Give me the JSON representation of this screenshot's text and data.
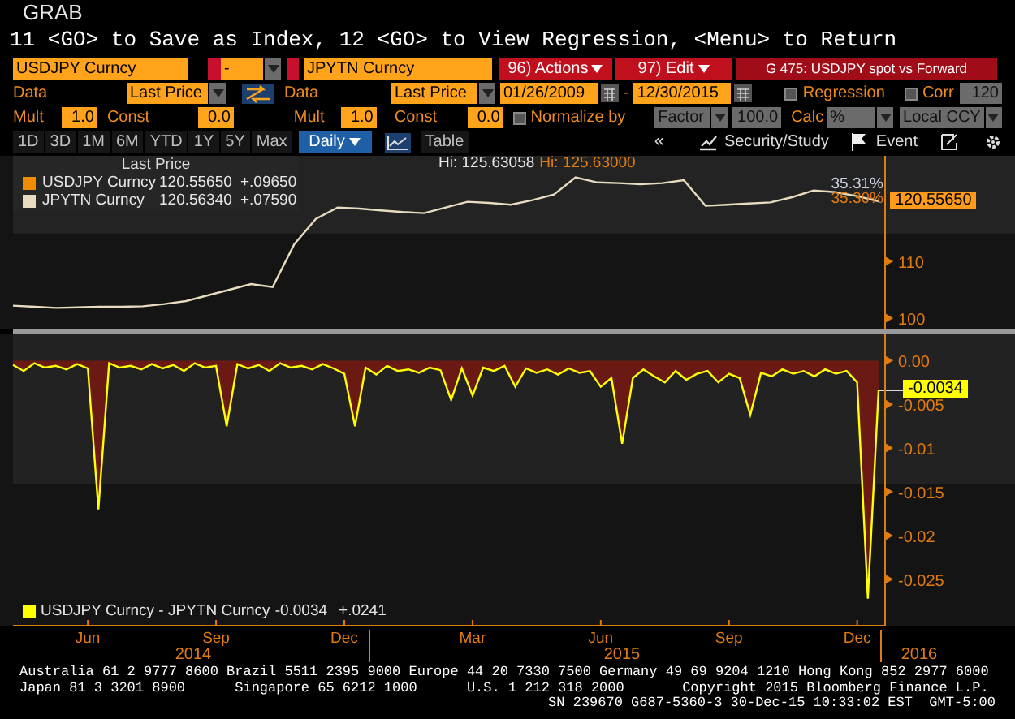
{
  "header": {
    "title": "GRAB",
    "command": "11 <GO> to Save as Index, 12 <GO> to View Regression, <Menu> to Return"
  },
  "toolbar": {
    "security_1": "USDJPY Curncy",
    "operator": "-",
    "security_2": "JPYTN Curncy",
    "actions": "96) Actions",
    "edit": "97) Edit",
    "chart_title": "G 475: USDJPY spot vs Forward"
  },
  "data_row": {
    "data_label_1": "Data",
    "field_1": "Last Price",
    "data_label_2": "Data",
    "field_2": "Last Price",
    "start_date": "01/26/2009",
    "date_separator": "-",
    "end_date": "12/30/2015",
    "options": [
      {
        "label": "Regression",
        "checked": false
      },
      {
        "label": "Corr",
        "checked": false
      }
    ],
    "corr_period": "120"
  },
  "scale_row": {
    "mult_label_1": "Mult",
    "mult_1": "1.0",
    "const_label_1": "Const",
    "const_1": "0.0",
    "mult_label_2": "Mult",
    "mult_2": "1.0",
    "const_label_2": "Const",
    "const_2": "0.0",
    "normalize": {
      "label": "Normalize by",
      "checked": false
    },
    "factor": "Factor",
    "factor_value": "100.0",
    "calc_label": "Calc",
    "calc": "%",
    "currency": "Local CCY"
  },
  "period_row": {
    "periods": [
      {
        "label": "1D",
        "selected": false
      },
      {
        "label": "3D",
        "selected": false
      },
      {
        "label": "1M",
        "selected": false
      },
      {
        "label": "6M",
        "selected": false
      },
      {
        "label": "YTD",
        "selected": false
      },
      {
        "label": "1Y",
        "selected": false
      },
      {
        "label": "5Y",
        "selected": false
      },
      {
        "label": "Max",
        "selected": false
      }
    ],
    "frequency": "Daily",
    "table": "Table",
    "collapse": "«",
    "security_study": "Security/Study",
    "event": "Event"
  },
  "price_chart": {
    "legend": {
      "title": "Last Price",
      "items": [
        {
          "name": "USDJPY Curncy",
          "value": "120.55650",
          "change": "+.09650",
          "color": "#f08c00"
        },
        {
          "value": "120.56340",
          "change": "+.07590"
        }
      ]
    },
    "hi_labels": [
      {
        "text": "Hi: 125.63058",
        "color": "#e6e6e6"
      },
      {
        "text": "Hi: 125.63000",
        "color": "#e07b10"
      }
    ],
    "pct_labels": [
      {
        "text": "35.31%",
        "color": "#c8d0e0"
      },
      {
        "text": "35.30%",
        "color": "#e07b10"
      }
    ],
    "last_value": "120.55650",
    "chart_data": {
      "type": "line",
      "ylim": [
        98,
        128.6
      ],
      "yticks": [
        100,
        110
      ],
      "bands": [
        {
          "axis": "y",
          "from": 114.9,
          "to": 128.6,
          "color": "#232323"
        }
      ],
      "categories": [
        null,
        null,
        null,
        null,
        null,
        null,
        null,
        null,
        null,
        null,
        null,
        null,
        null,
        null,
        null,
        null,
        null,
        null,
        null,
        null,
        null,
        null,
        null,
        null,
        null,
        null,
        null,
        null,
        null,
        null,
        null,
        null,
        null,
        null,
        null,
        null,
        null,
        null,
        null,
        null,
        null
      ],
      "series": [
        {
          "name": "JPYTN Curncy",
          "color": "#e8dcc0",
          "values": [
            102.2,
            102,
            101.8,
            101.9,
            102,
            102,
            102.1,
            102.5,
            103,
            104,
            105,
            106,
            105.5,
            113,
            117.5,
            119.5,
            119.3,
            119,
            118.7,
            118.5,
            119.5,
            120.5,
            120.3,
            120,
            120.8,
            121.8,
            124.8,
            123.9,
            123.8,
            123.6,
            123.8,
            124.3,
            119.8,
            120,
            120.2,
            120.4,
            121.3,
            122.5,
            122.2,
            121.5,
            120.6
          ]
        }
      ]
    }
  },
  "spread_chart": {
    "legend": {
      "value": "-0.0034",
      "change": "+.0241"
    },
    "last_value": "-0.0034",
    "chart_data": {
      "type": "area",
      "ylim": [
        -0.0304,
        0.003
      ],
      "bands": [
        {
          "axis": "y",
          "from": -0.0141,
          "to": 0.003,
          "color": "#222222"
        }
      ],
      "yticks": [
        {
          "value": 0,
          "label": "0.00"
        },
        {
          "value": -0.005,
          "label": "-0.005"
        },
        {
          "value": -0.01,
          "label": "-0.01"
        },
        {
          "value": -0.015,
          "label": "-0.015"
        },
        {
          "value": -0.02,
          "label": "-0.02"
        },
        {
          "value": -0.025,
          "label": "-0.025"
        }
      ],
      "categories": [
        null,
        null,
        null,
        null,
        null,
        null,
        null,
        "Jun",
        null,
        null,
        null,
        null,
        null,
        null,
        null,
        null,
        null,
        null,
        null,
        "Sep",
        null,
        null,
        null,
        null,
        null,
        null,
        null,
        null,
        null,
        null,
        null,
        "Dec",
        null,
        null,
        null,
        null,
        null,
        null,
        null,
        null,
        null,
        null,
        null,
        "Mar",
        null,
        null,
        null,
        null,
        null,
        null,
        null,
        null,
        null,
        null,
        null,
        "Jun",
        null,
        null,
        null,
        null,
        null,
        null,
        null,
        null,
        null,
        null,
        null,
        "Sep",
        null,
        null,
        null,
        null,
        null,
        null,
        null,
        null,
        null,
        null,
        null,
        "Dec",
        null,
        null
      ],
      "series": [
        {
          "name": "USDJPY Curncy - JPYTN Curncy",
          "color": "#ffff00",
          "values": [
            -0.0005,
            -0.0012,
            -0.0003,
            -0.0008,
            -0.0006,
            -0.001,
            -0.0004,
            -0.0009,
            -0.017,
            -0.0003,
            -0.0008,
            -0.0006,
            -0.001,
            -0.0004,
            -0.0009,
            -0.0005,
            -0.0012,
            -0.0003,
            -0.0008,
            -0.0006,
            -0.0075,
            -0.0004,
            -0.0009,
            -0.0005,
            -0.0012,
            -0.0003,
            -0.0008,
            -0.0006,
            -0.001,
            -0.0004,
            -0.0009,
            -0.0015,
            -0.0075,
            -0.0008,
            -0.0016,
            -0.0006,
            -0.0012,
            -0.001,
            -0.0014,
            -0.0008,
            -0.0011,
            -0.0045,
            -0.0009,
            -0.004,
            -0.0008,
            -0.0012,
            -0.0006,
            -0.003,
            -0.0009,
            -0.0014,
            -0.001,
            -0.0016,
            -0.0009,
            -0.0014,
            -0.0012,
            -0.003,
            -0.002,
            -0.0095,
            -0.002,
            -0.001,
            -0.0018,
            -0.0025,
            -0.0012,
            -0.0022,
            -0.0015,
            -0.0012,
            -0.0025,
            -0.0015,
            -0.002,
            -0.0062,
            -0.0014,
            -0.0018,
            -0.001,
            -0.0015,
            -0.0012,
            -0.0018,
            -0.001,
            -0.0015,
            -0.0012,
            -0.0025,
            -0.0272,
            -0.0034
          ]
        }
      ]
    }
  },
  "x_axis_years": [
    "2014",
    "2015",
    "2016"
  ],
  "footer": [
    "Australia 61 2 9777 8600 Brazil 5511 2395 9000 Europe 44 20 7330 7500 Germany 49 69 9204 1210 Hong Kong 852 2977 6000",
    "Japan 81 3 3201 8900      Singapore 65 6212 1000      U.S. 1 212 318 2000       Copyright 2015 Bloomberg Finance L.P.",
    "SN 239670 G687-5360-3 30-Dec-15 10:33:02 EST  GMT-5:00"
  ]
}
